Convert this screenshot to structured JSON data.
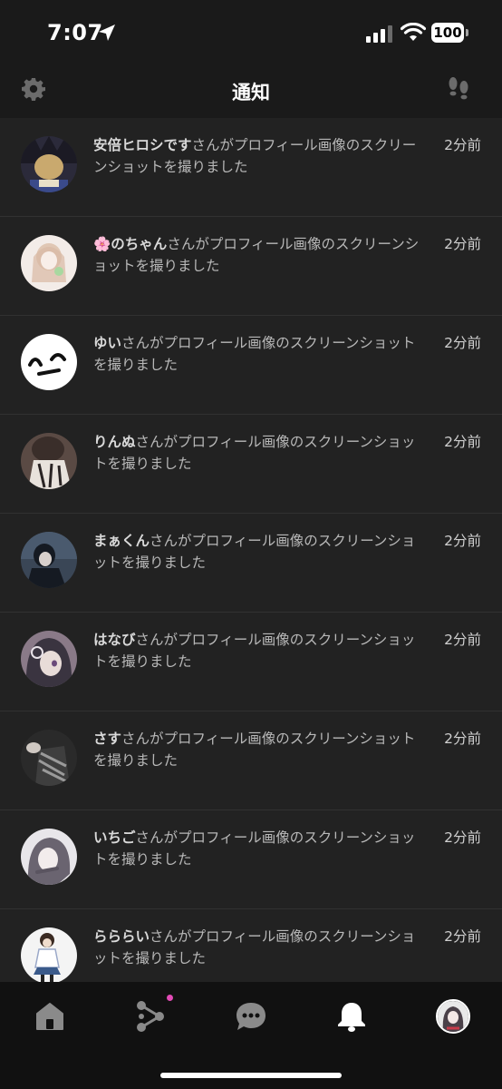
{
  "status_bar": {
    "time": "7:07",
    "battery": "100"
  },
  "header": {
    "title": "通知"
  },
  "notifications": [
    {
      "user": "安倍ヒロシです",
      "text": "さんがプロフィール画像のスクリーンショットを撮りました",
      "time": "2分前",
      "avatar_colors": [
        "#c9a96e",
        "#2b2a3a"
      ]
    },
    {
      "user": "🌸のちゃん",
      "text": "さんがプロフィール画像のスクリーンショットを撮りました",
      "time": "2分前",
      "avatar_colors": [
        "#f3ece8",
        "#d8b9a4"
      ]
    },
    {
      "user": "ゆい",
      "text": "さんがプロフィール画像のスクリーンショットを撮りました",
      "time": "2分前",
      "avatar_colors": [
        "#ffffff",
        "#111111"
      ]
    },
    {
      "user": "りんぬ",
      "text": "さんがプロフィール画像のスクリーンショットを撮りました",
      "time": "2分前",
      "avatar_colors": [
        "#5a4a44",
        "#e8e2dc"
      ]
    },
    {
      "user": "まぁくん",
      "text": "さんがプロフィール画像のスクリーンショットを撮りました",
      "time": "2分前",
      "avatar_colors": [
        "#3a4656",
        "#151a22"
      ]
    },
    {
      "user": "はなび",
      "text": "さんがプロフィール画像のスクリーンショットを撮りました",
      "time": "2分前",
      "avatar_colors": [
        "#8a7a88",
        "#3a3440"
      ]
    },
    {
      "user": "さす",
      "text": "さんがプロフィール画像のスクリーンショットを撮りました",
      "time": "2分前",
      "avatar_colors": [
        "#2a2a2a",
        "#9a9a9a"
      ]
    },
    {
      "user": "いちご",
      "text": "さんがプロフィール画像のスクリーンショットを撮りました",
      "time": "2分前",
      "avatar_colors": [
        "#e8e6ea",
        "#6a6470"
      ]
    },
    {
      "user": "らららい",
      "text": "さんがプロフィール画像のスクリーンショットを撮りました",
      "time": "2分前",
      "avatar_colors": [
        "#f4f4f4",
        "#3a5a8a"
      ]
    }
  ],
  "nav": {
    "items": [
      "home-icon",
      "connect-icon",
      "chat-icon",
      "bell-icon",
      "profile-avatar"
    ],
    "active": "bell-icon",
    "badge_color": "#e24bb6"
  }
}
